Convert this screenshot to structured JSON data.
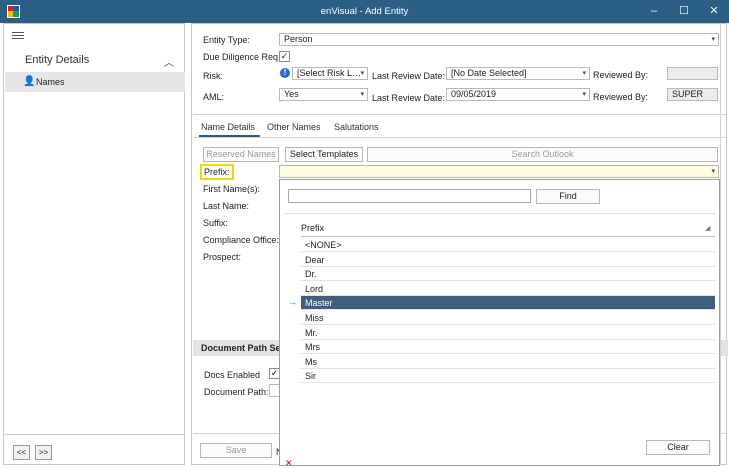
{
  "window": {
    "title": "enVisual - Add Entity",
    "minimize": "–",
    "maximize": "☐",
    "close": "✕"
  },
  "sidebar": {
    "section_title": "Entity Details",
    "items": [
      {
        "label": "Names"
      }
    ],
    "pager_prev": "<<",
    "pager_next": ">>"
  },
  "form": {
    "entity_type": {
      "label": "Entity Type:",
      "value": "Person"
    },
    "due_diligence": {
      "label": "Due Diligence Req.",
      "checked": "✓"
    },
    "risk": {
      "label": "Risk:",
      "value": "[Select Risk L…",
      "info": "!"
    },
    "aml": {
      "label": "AML:",
      "value": "Yes"
    },
    "last_review_1": {
      "label": "Last Review Date:",
      "value": "[No Date Selected]"
    },
    "last_review_2": {
      "label": "Last Review Date:",
      "value": "09/05/2019"
    },
    "reviewed_by_1": {
      "label": "Reviewed By:",
      "value": ""
    },
    "reviewed_by_2": {
      "label": "Reviewed By:",
      "value": "SUPER"
    }
  },
  "tabs": [
    {
      "label": "Name Details"
    },
    {
      "label": "Other Names"
    },
    {
      "label": "Salutations"
    }
  ],
  "name_details": {
    "reserved_names": "Reserved Names",
    "select_templates": "Select Templates",
    "search_outlook": "Search Outlook",
    "labels": {
      "prefix": "Prefix:",
      "first_names": "First Name(s):",
      "last_name": "Last Name:",
      "suffix": "Suffix:",
      "compliance_office": "Compliance Office:",
      "prospect": "Prospect:"
    }
  },
  "document_path": {
    "header": "Document Path Se",
    "docs_enabled": "Docs Enabled",
    "docs_enabled_checked": "✓",
    "document_path": "Document Path:"
  },
  "bottom": {
    "save": "Save",
    "partial": "N"
  },
  "popup": {
    "search_value": "",
    "find": "Find",
    "column_header": "Prefix",
    "rows": [
      "<NONE>",
      "Dear",
      "Dr.",
      "Lord",
      "Master",
      "Miss",
      "Mr.",
      "Mrs",
      "Ms",
      "Sir"
    ],
    "selected_index": 4,
    "selected_arrow": "→",
    "clear": "Clear",
    "error_mark": "✕"
  }
}
